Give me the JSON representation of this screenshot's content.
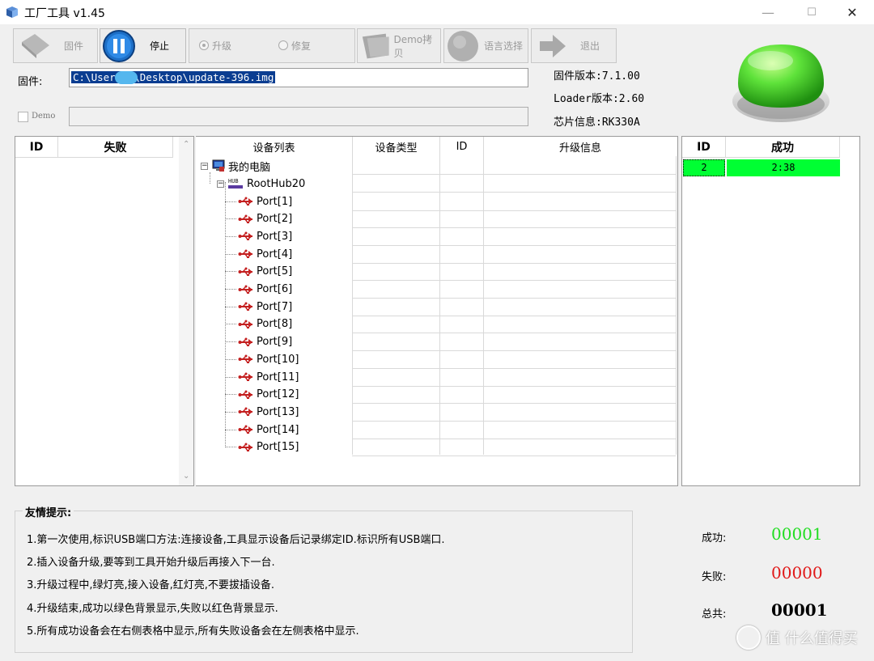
{
  "window": {
    "title": "工厂工具 v1.45",
    "minimize": "—",
    "maximize": "☐",
    "close": "✕"
  },
  "toolbar": {
    "firmware_label": "固件",
    "stop_label": "停止",
    "upgrade_label": "升级",
    "repair_label": "修复",
    "demo_copy_label": "Demo拷贝",
    "language_label": "语言选择",
    "exit_label": "退出"
  },
  "firmware": {
    "label": "固件:",
    "path": "C:\\Users\\      \\Desktop\\update-396.img"
  },
  "demo": {
    "label": "Demo",
    "value": ""
  },
  "info": {
    "firmware_version": "固件版本:7.1.00",
    "loader_version": "Loader版本:2.60",
    "chip_info": "芯片信息:RK330A"
  },
  "fail_table": {
    "col_id": "ID",
    "col_fail": "失败"
  },
  "device_tree": {
    "columns": [
      "设备列表",
      "设备类型",
      "ID",
      "升级信息"
    ],
    "root": "我的电脑",
    "hub": "RootHub20",
    "ports": [
      "Port[1]",
      "Port[2]",
      "Port[3]",
      "Port[4]",
      "Port[5]",
      "Port[6]",
      "Port[7]",
      "Port[8]",
      "Port[9]",
      "Port[10]",
      "Port[11]",
      "Port[12]",
      "Port[13]",
      "Port[14]",
      "Port[15]"
    ]
  },
  "success_table": {
    "col_id": "ID",
    "col_success": "成功",
    "rows": [
      {
        "id": "2",
        "value": "2:38"
      }
    ],
    "row_color": "#00ff33"
  },
  "tips": {
    "title": "友情提示:",
    "items": [
      "1.第一次使用,标识USB端口方法:连接设备,工具显示设备后记录绑定ID.标识所有USB端口.",
      "2.插入设备升级,要等到工具开始升级后再接入下一台.",
      "3.升级过程中,绿灯亮,接入设备,红灯亮,不要拔插设备.",
      "4.升级结束,成功以绿色背景显示,失败以红色背景显示.",
      "5.所有成功设备会在右侧表格中显示,所有失败设备会在左侧表格中显示."
    ]
  },
  "counters": {
    "success_label": "成功:",
    "success_value": "00001",
    "success_color": "#22dd22",
    "fail_label": "失败:",
    "fail_value": "00000",
    "fail_color": "#e01818",
    "total_label": "总共:",
    "total_value": "00001"
  },
  "watermark": "值 什么值得买"
}
